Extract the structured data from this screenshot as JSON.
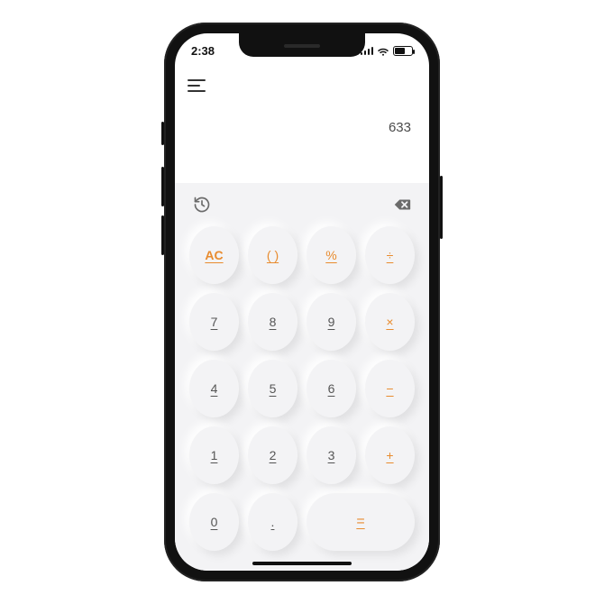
{
  "status": {
    "time": "2:38"
  },
  "display": {
    "value": "633"
  },
  "keys": {
    "ac": "AC",
    "paren": "( )",
    "pct": "%",
    "div": "÷",
    "k7": "7",
    "k8": "8",
    "k9": "9",
    "mul": "×",
    "k4": "4",
    "k5": "5",
    "k6": "6",
    "sub": "−",
    "k1": "1",
    "k2": "2",
    "k3": "3",
    "add": "+",
    "k0": "0",
    "dot": ".",
    "eq": "="
  }
}
